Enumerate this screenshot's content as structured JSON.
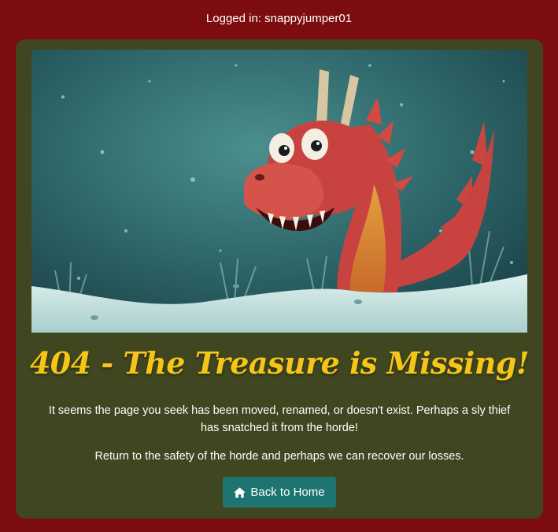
{
  "header": {
    "login_text": "Logged in: snappyjumper01"
  },
  "hero": {
    "image_alt": "Cartoon red dragon peeking out of snow"
  },
  "main": {
    "headline": "404 - The Treasure is Missing!",
    "message_1": "It seems the page you seek has been moved, renamed, or doesn't exist. Perhaps a sly thief has snatched it from the horde!",
    "message_2": "Return to the safety of the horde and perhaps we can recover our losses.",
    "button_label": "Back to Home",
    "button_icon": "home-icon"
  },
  "colors": {
    "page_background": "#7d0c0e",
    "card_background": "#3f4620",
    "headline": "#f5c518",
    "button": "#1d7470"
  }
}
